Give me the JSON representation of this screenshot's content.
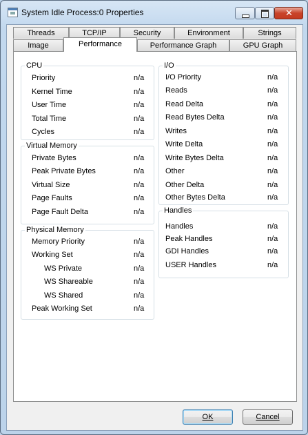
{
  "window": {
    "title": "System Idle Process:0 Properties"
  },
  "tabs_top": [
    "Threads",
    "TCP/IP",
    "Security",
    "Environment",
    "Strings"
  ],
  "tabs_bottom": [
    "Image",
    "Performance",
    "Performance Graph",
    "GPU Graph"
  ],
  "active_tab": "Performance",
  "cpu": {
    "title": "CPU",
    "rows": [
      {
        "label": "Priority",
        "value": "n/a"
      },
      {
        "label": "Kernel Time",
        "value": "n/a"
      },
      {
        "label": "User Time",
        "value": "n/a"
      },
      {
        "label": "Total Time",
        "value": "n/a"
      },
      {
        "label": "Cycles",
        "value": "n/a"
      }
    ]
  },
  "virtual_memory": {
    "title": "Virtual Memory",
    "rows": [
      {
        "label": "Private Bytes",
        "value": "n/a"
      },
      {
        "label": "Peak Private Bytes",
        "value": "n/a"
      },
      {
        "label": "Virtual Size",
        "value": "n/a"
      },
      {
        "label": "Page Faults",
        "value": "n/a"
      },
      {
        "label": "Page Fault Delta",
        "value": "n/a"
      }
    ]
  },
  "physical_memory": {
    "title": "Physical Memory",
    "rows": [
      {
        "label": "Memory Priority",
        "value": "n/a"
      },
      {
        "label": "Working Set",
        "value": "n/a"
      },
      {
        "label": "WS Private",
        "value": "n/a"
      },
      {
        "label": "WS Shareable",
        "value": "n/a"
      },
      {
        "label": "WS Shared",
        "value": "n/a"
      },
      {
        "label": "Peak Working Set",
        "value": "n/a"
      }
    ]
  },
  "io": {
    "title": "I/O",
    "rows": [
      {
        "label": "I/O Priority",
        "value": "n/a"
      },
      {
        "label": "Reads",
        "value": "n/a"
      },
      {
        "label": "Read Delta",
        "value": "n/a"
      },
      {
        "label": "Read Bytes Delta",
        "value": "n/a"
      },
      {
        "label": "Writes",
        "value": "n/a"
      },
      {
        "label": "Write Delta",
        "value": "n/a"
      },
      {
        "label": "Write Bytes Delta",
        "value": "n/a"
      },
      {
        "label": "Other",
        "value": "n/a"
      },
      {
        "label": "Other Delta",
        "value": "n/a"
      },
      {
        "label": "Other Bytes Delta",
        "value": "n/a"
      }
    ]
  },
  "handles": {
    "title": "Handles",
    "rows": [
      {
        "label": "Handles",
        "value": "n/a"
      },
      {
        "label": "Peak Handles",
        "value": "n/a"
      },
      {
        "label": "GDI Handles",
        "value": "n/a"
      },
      {
        "label": "USER Handles",
        "value": "n/a"
      }
    ]
  },
  "buttons": {
    "ok": "OK",
    "cancel": "Cancel"
  }
}
